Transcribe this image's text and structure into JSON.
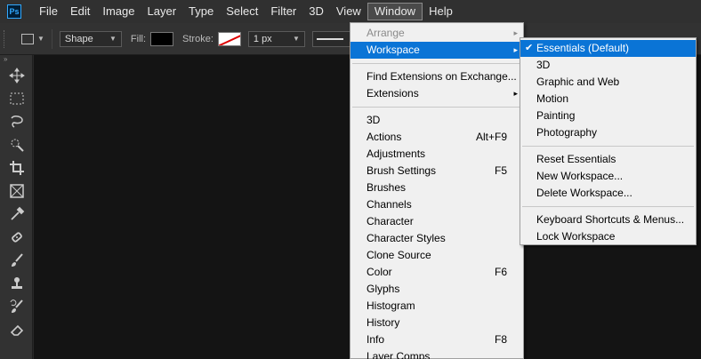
{
  "app": {
    "logo": "Ps"
  },
  "menubar": {
    "items": [
      {
        "label": "File"
      },
      {
        "label": "Edit"
      },
      {
        "label": "Image"
      },
      {
        "label": "Layer"
      },
      {
        "label": "Type"
      },
      {
        "label": "Select"
      },
      {
        "label": "Filter"
      },
      {
        "label": "3D"
      },
      {
        "label": "View"
      },
      {
        "label": "Window"
      },
      {
        "label": "Help"
      }
    ],
    "open": "Window"
  },
  "options": {
    "mode": "Shape",
    "fill_label": "Fill:",
    "stroke_label": "Stroke:",
    "stroke_width": "1 px"
  },
  "window_menu": {
    "items": [
      {
        "label": "Arrange",
        "disabled": true,
        "arrow": "▸"
      },
      {
        "label": "Workspace",
        "highlighted": true,
        "arrow": "▸"
      },
      {
        "separator": true
      },
      {
        "label": "Find Extensions on Exchange..."
      },
      {
        "label": "Extensions",
        "arrow": "▸"
      },
      {
        "separator": true
      },
      {
        "label": "3D"
      },
      {
        "label": "Actions",
        "shortcut": "Alt+F9"
      },
      {
        "label": "Adjustments"
      },
      {
        "label": "Brush Settings",
        "shortcut": "F5"
      },
      {
        "label": "Brushes"
      },
      {
        "label": "Channels"
      },
      {
        "label": "Character"
      },
      {
        "label": "Character Styles"
      },
      {
        "label": "Clone Source"
      },
      {
        "label": "Color",
        "shortcut": "F6"
      },
      {
        "label": "Glyphs"
      },
      {
        "label": "Histogram"
      },
      {
        "label": "History"
      },
      {
        "label": "Info",
        "shortcut": "F8"
      },
      {
        "label": "Layer Comps"
      }
    ]
  },
  "workspace_menu": {
    "items": [
      {
        "label": "Essentials (Default)",
        "highlighted": true,
        "checked": true,
        "check": "✔"
      },
      {
        "label": "3D"
      },
      {
        "label": "Graphic and Web"
      },
      {
        "label": "Motion"
      },
      {
        "label": "Painting"
      },
      {
        "label": "Photography"
      },
      {
        "separator": true
      },
      {
        "label": "Reset Essentials"
      },
      {
        "label": "New Workspace..."
      },
      {
        "label": "Delete Workspace..."
      },
      {
        "separator": true
      },
      {
        "label": "Keyboard Shortcuts & Menus..."
      },
      {
        "label": "Lock Workspace"
      }
    ]
  },
  "toolbar": {
    "tools": [
      {
        "icon": "move-icon"
      },
      {
        "icon": "marquee-icon"
      },
      {
        "icon": "lasso-icon"
      },
      {
        "icon": "quick-selection-icon"
      },
      {
        "icon": "crop-icon"
      },
      {
        "icon": "frame-icon"
      },
      {
        "icon": "eyedropper-icon"
      },
      {
        "icon": "healing-brush-icon"
      },
      {
        "icon": "brush-icon"
      },
      {
        "icon": "clone-stamp-icon"
      },
      {
        "icon": "history-brush-icon"
      },
      {
        "icon": "eraser-icon"
      }
    ]
  },
  "colors": {
    "menubar_bg": "#303030",
    "canvas_bg": "#141414",
    "menu_bg": "#f0f0f0",
    "highlight": "#0a74d6"
  }
}
